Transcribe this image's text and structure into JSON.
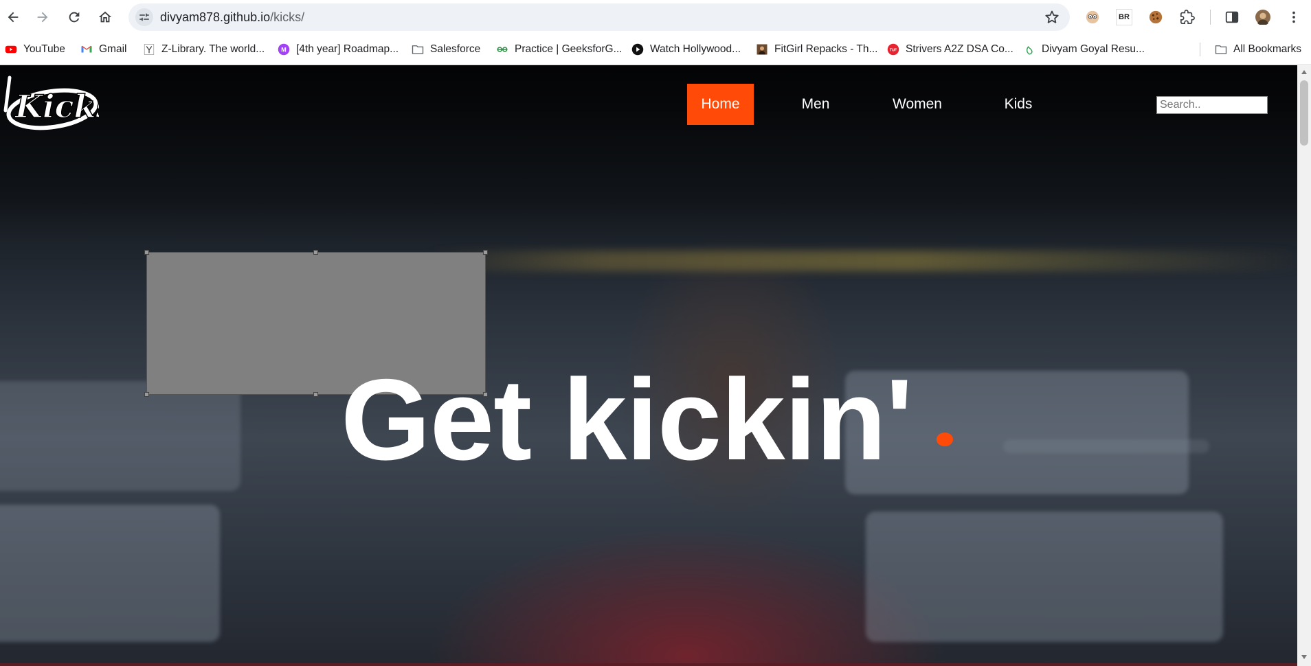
{
  "browser": {
    "url_host": "divyam878.github.io",
    "url_path": "/kicks/",
    "bookmarks": [
      {
        "label": "YouTube",
        "icon": "youtube-icon"
      },
      {
        "label": "Gmail",
        "icon": "gmail-icon"
      },
      {
        "label": "Z-Library. The world...",
        "icon": "zlibrary-icon"
      },
      {
        "label": "[4th year] Roadmap...",
        "icon": "m-badge-icon"
      },
      {
        "label": "Salesforce",
        "icon": "folder-icon"
      },
      {
        "label": "Practice | GeeksforG...",
        "icon": "geeksforgeeks-icon"
      },
      {
        "label": "Watch Hollywood...",
        "icon": "play-icon"
      },
      {
        "label": "FitGirl Repacks - Th...",
        "icon": "fitgirl-icon"
      },
      {
        "label": "Strivers A2Z DSA Co...",
        "icon": "tuf-icon"
      },
      {
        "label": "Divyam Goyal Resu...",
        "icon": "leaf-icon"
      }
    ],
    "all_bookmarks_label": "All Bookmarks",
    "ext_br_label": "BR"
  },
  "site": {
    "logo_text": "Kicks",
    "nav": [
      {
        "label": "Home",
        "active": true
      },
      {
        "label": "Men",
        "active": false
      },
      {
        "label": "Women",
        "active": false
      },
      {
        "label": "Kids",
        "active": false
      }
    ],
    "search_placeholder": "Search..",
    "hero_title": "Get kickin'",
    "accent_color": "#ff4a08"
  }
}
